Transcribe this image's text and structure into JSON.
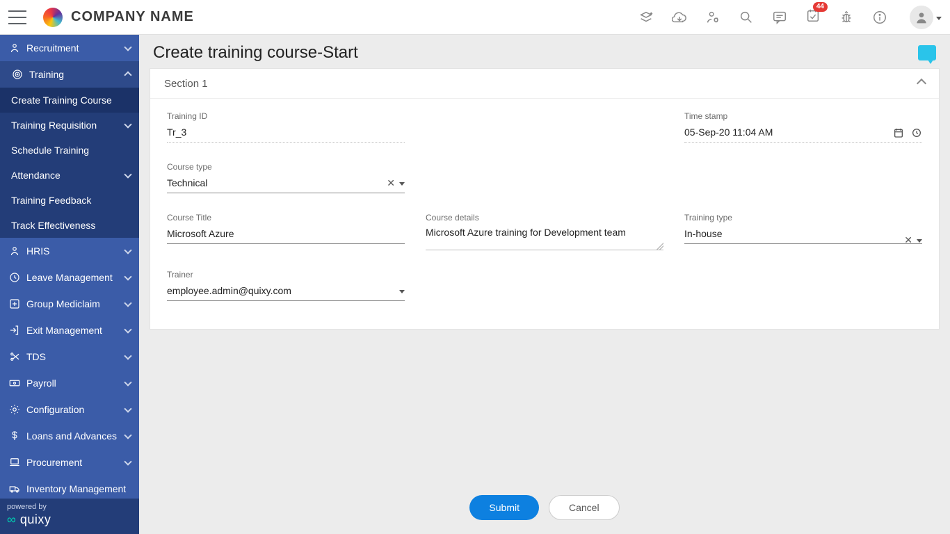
{
  "header": {
    "company": "COMPANY NAME",
    "badge_count": "44"
  },
  "sidebar": {
    "items": [
      {
        "label": "Recruitment"
      },
      {
        "label": "Training"
      },
      {
        "label": "Create Training Course"
      },
      {
        "label": "Training Requisition"
      },
      {
        "label": "Schedule Training"
      },
      {
        "label": "Attendance"
      },
      {
        "label": "Training Feedback"
      },
      {
        "label": "Track Effectiveness"
      },
      {
        "label": "HRIS"
      },
      {
        "label": "Leave Management"
      },
      {
        "label": "Group Mediclaim"
      },
      {
        "label": "Exit Management"
      },
      {
        "label": "TDS"
      },
      {
        "label": "Payroll"
      },
      {
        "label": "Configuration"
      },
      {
        "label": "Loans and Advances"
      },
      {
        "label": "Procurement"
      },
      {
        "label": "Inventory Management"
      }
    ],
    "powered": "powered by",
    "brand": "quixy"
  },
  "page": {
    "title": "Create training course-Start",
    "section_title": "Section 1",
    "submit": "Submit",
    "cancel": "Cancel"
  },
  "form": {
    "training_id_label": "Training ID",
    "training_id_value": "Tr_3",
    "timestamp_label": "Time stamp",
    "timestamp_value": "05-Sep-20 11:04 AM",
    "course_type_label": "Course type",
    "course_type_value": "Technical",
    "course_title_label": "Course Title",
    "course_title_value": "Microsoft Azure",
    "course_details_label": "Course details",
    "course_details_value": "Microsoft Azure training for Development team",
    "training_type_label": "Training type",
    "training_type_value": "In-house",
    "trainer_label": "Trainer",
    "trainer_value": "employee.admin@quixy.com"
  }
}
